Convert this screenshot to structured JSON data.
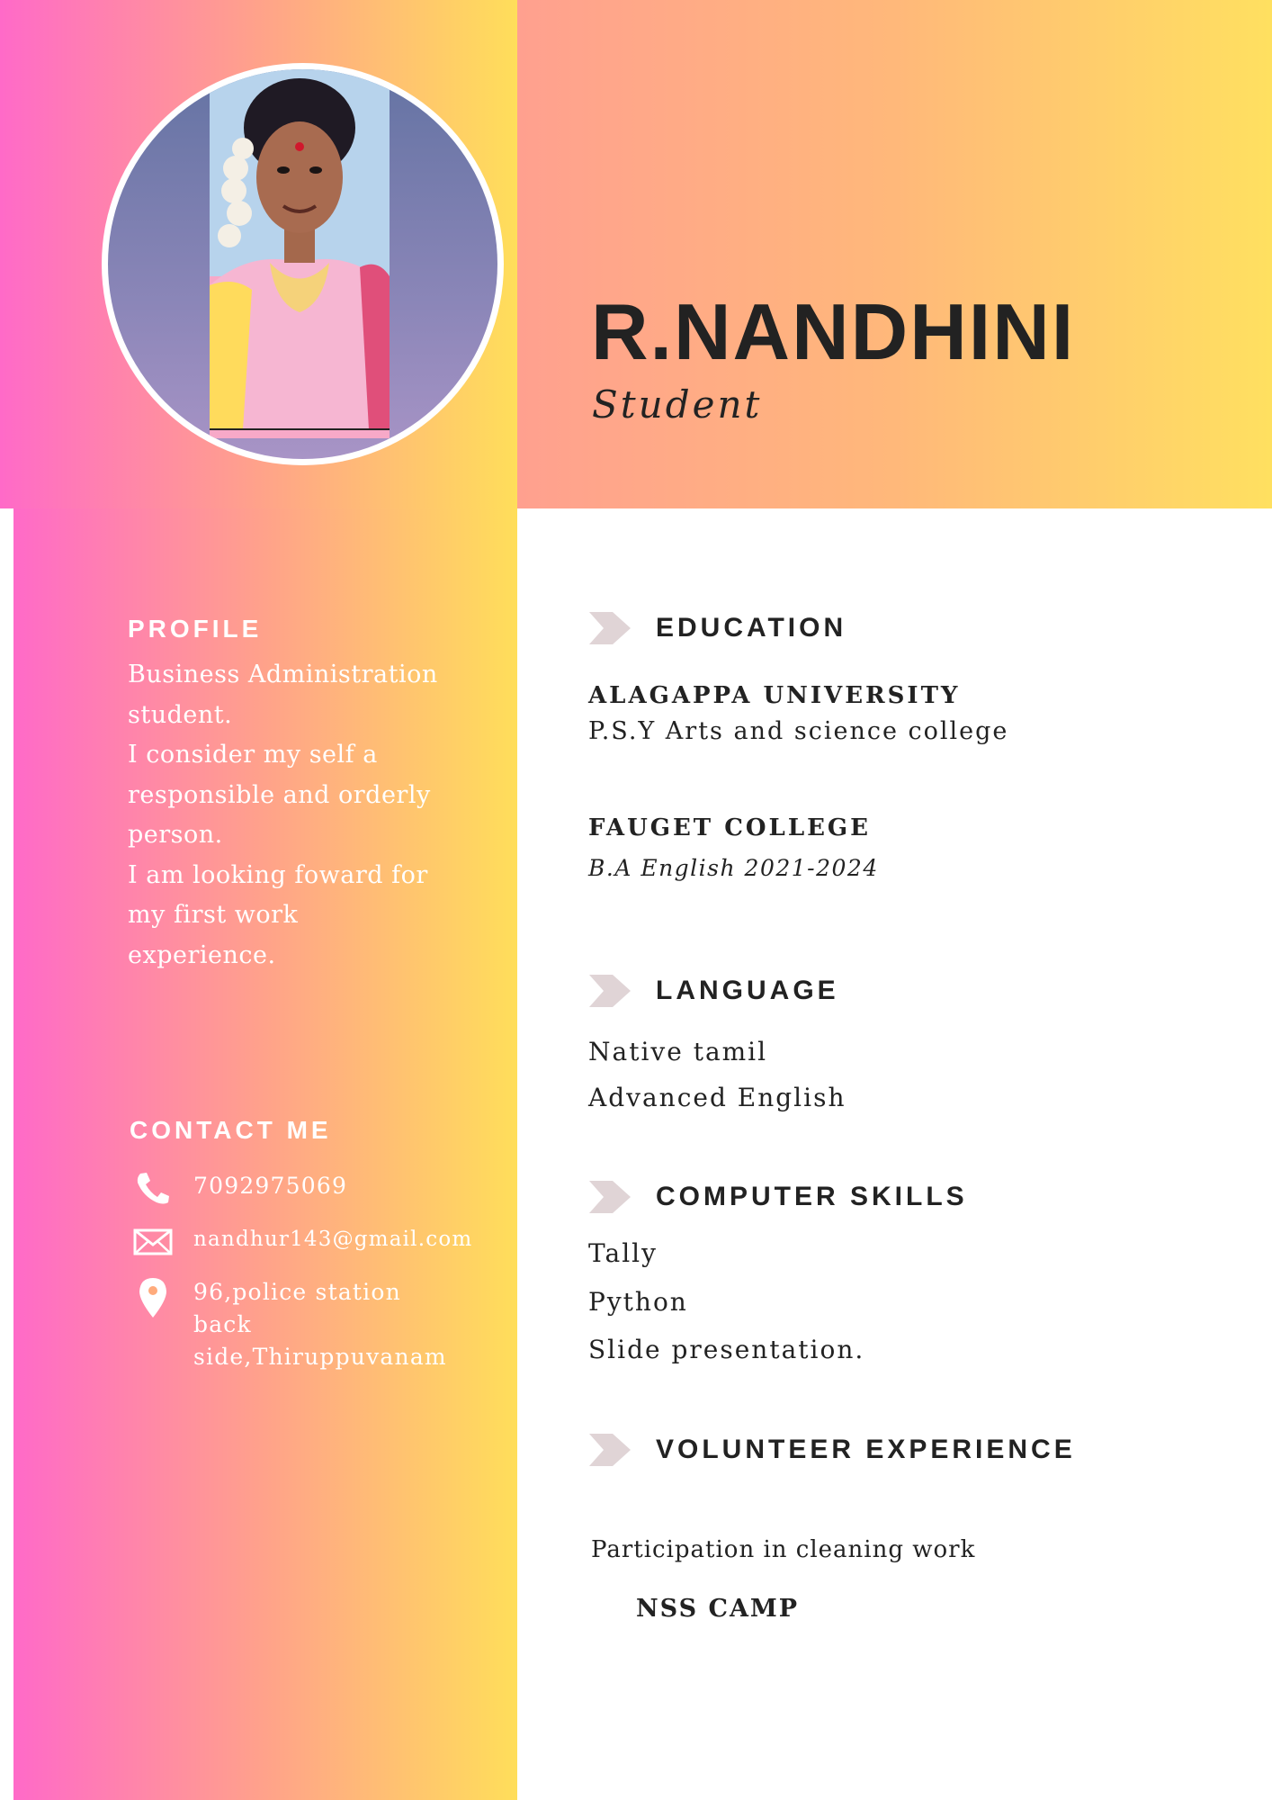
{
  "header": {
    "name": "R.NANDHINI",
    "role": "Student"
  },
  "photo": {
    "alt": "profile photo"
  },
  "profile": {
    "heading": "PROFILE",
    "lines": [
      "Business Administration",
      "student.",
      "I consider my self a",
      "responsible and orderly",
      "person.",
      "I am looking foward for",
      "my first work",
      "experience."
    ]
  },
  "contact": {
    "heading": "CONTACT ME",
    "phone": "7092975069",
    "email": "nandhur143@gmail.com",
    "address_lines": [
      "96,police station",
      "back",
      "side,Thiruppuvanam"
    ],
    "phone_icon": "phone-icon",
    "email_icon": "mail-icon",
    "address_icon": "location-pin-icon"
  },
  "education": {
    "heading": "EDUCATION",
    "entries": [
      {
        "school": "ALAGAPPA UNIVERSITY",
        "detail": "P.S.Y Arts and science college"
      },
      {
        "school": "FAUGET COLLEGE",
        "detail": "B.A English 2021-2024"
      }
    ]
  },
  "language": {
    "heading": "LANGUAGE",
    "items": [
      "Native tamil",
      "Advanced English"
    ]
  },
  "skills": {
    "heading": "COMPUTER SKILLS",
    "items": [
      "Tally",
      "Python",
      "Slide presentation."
    ]
  },
  "volunteer": {
    "heading": "VOLUNTEER EXPERIENCE",
    "description": "Participation in cleaning work",
    "title": "NSS CAMP"
  },
  "colors": {
    "gradient_left": "#ff6ac8",
    "gradient_mid": "#ffa28a",
    "gradient_right": "#ffde5a",
    "heading_text": "#222222",
    "arrow": "#e0d4d6"
  }
}
